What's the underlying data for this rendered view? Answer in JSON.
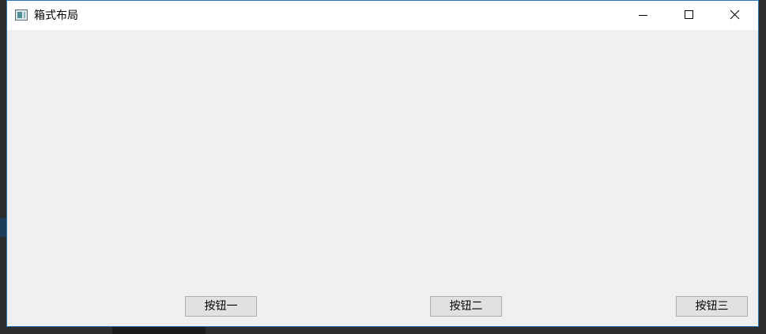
{
  "window": {
    "title": "箱式布局",
    "icon": "app-window-icon",
    "controls": {
      "minimize_icon": "minimize-icon",
      "maximize_icon": "maximize-icon",
      "close_icon": "close-icon"
    }
  },
  "buttons": [
    {
      "label": "按钮一"
    },
    {
      "label": "按钮二"
    },
    {
      "label": "按钮三"
    }
  ],
  "colors": {
    "titlebar_bg": "#ffffff",
    "client_bg": "#f0f0f0",
    "button_bg": "#e1e1e1",
    "button_border": "#adadad",
    "window_border": "#2b78c2"
  }
}
